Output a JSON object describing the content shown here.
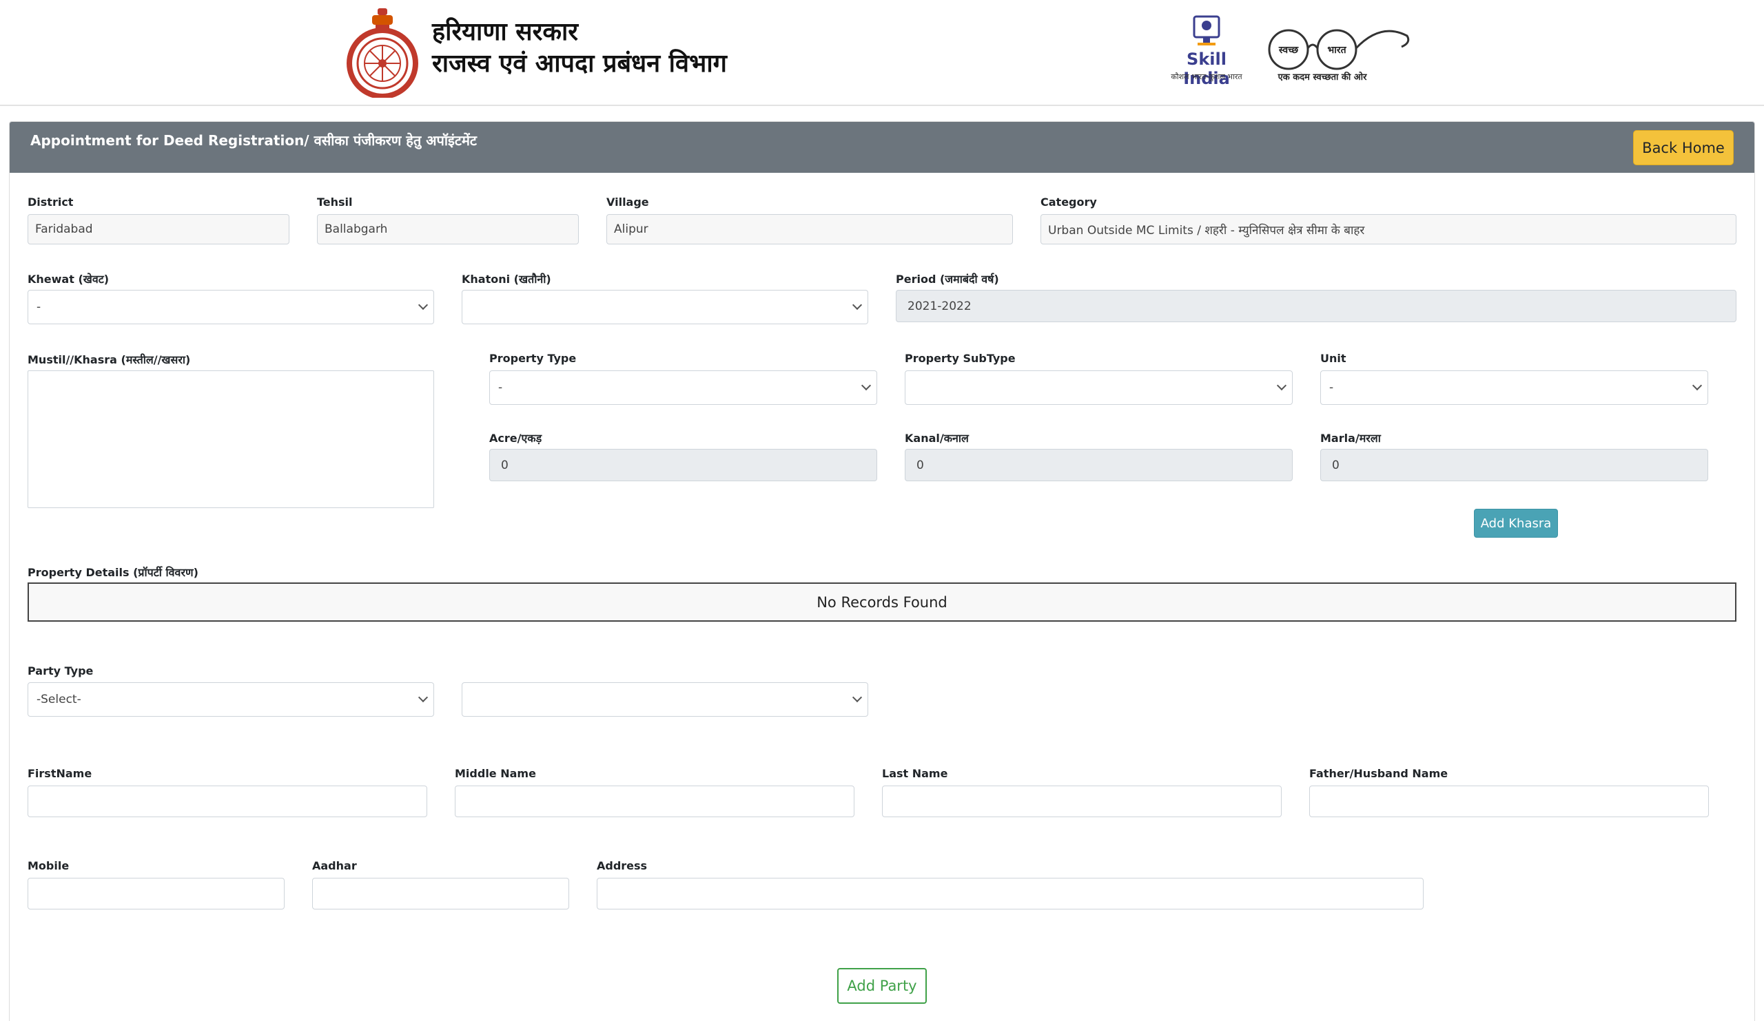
{
  "header": {
    "gov_line1": "हरियाणा सरकार",
    "gov_line2": "राजस्व एवं आपदा प्रबंधन विभाग",
    "skill_india": "Skill India",
    "skill_tagline": "कौशल भारत-कुशल भारत",
    "swachh_left": "स्वच्छ",
    "swachh_right": "भारत",
    "swachh_tagline": "एक कदम स्वच्छता की ओर"
  },
  "card": {
    "title": "Appointment for Deed Registration/ वसीका पंजीकरण हेतु अपॉइंटमेंट",
    "back_home": "Back Home"
  },
  "location": {
    "district_label": "District",
    "district_value": "Faridabad",
    "tehsil_label": "Tehsil",
    "tehsil_value": "Ballabgarh",
    "village_label": "Village",
    "village_value": "Alipur",
    "category_label": "Category",
    "category_value": "Urban Outside MC Limits / शहरी - म्युनिसिपल क्षेत्र सीमा के बाहर"
  },
  "land": {
    "khewat_label": "Khewat (खेवट)",
    "khewat_value": "-",
    "khatoni_label": "Khatoni (खतौनी)",
    "khatoni_value": "",
    "period_label": "Period (जमाबंदी वर्ष)",
    "period_value": "2021-2022",
    "mustil_label": "Mustil//Khasra (मस्तील//खसरा)",
    "property_type_label": "Property Type",
    "property_type_value": "-",
    "property_subtype_label": "Property SubType",
    "property_subtype_value": "",
    "unit_label": "Unit",
    "unit_value": "-",
    "acre_label": "Acre/एकड़",
    "acre_value": "0",
    "kanal_label": "Kanal/कनाल",
    "kanal_value": "0",
    "marla_label": "Marla/मरला",
    "marla_value": "0",
    "add_khasra": "Add Khasra"
  },
  "property_details": {
    "label": "Property Details (प्रॉपर्टी विवरण)",
    "empty_text": "No Records Found"
  },
  "party": {
    "type_label": "Party Type",
    "type_value": "-Select-",
    "subtype_value": "",
    "firstname_label": "FirstName",
    "middlename_label": "Middle Name",
    "lastname_label": "Last Name",
    "father_label": "Father/Husband Name",
    "mobile_label": "Mobile",
    "aadhar_label": "Aadhar",
    "address_label": "Address",
    "add_party": "Add Party"
  },
  "colors": {
    "card_header": "#6c757d",
    "back_home_button": "#f4c23b",
    "add_khasra_button": "#4aa3b5",
    "add_party_border": "#3fa148"
  }
}
